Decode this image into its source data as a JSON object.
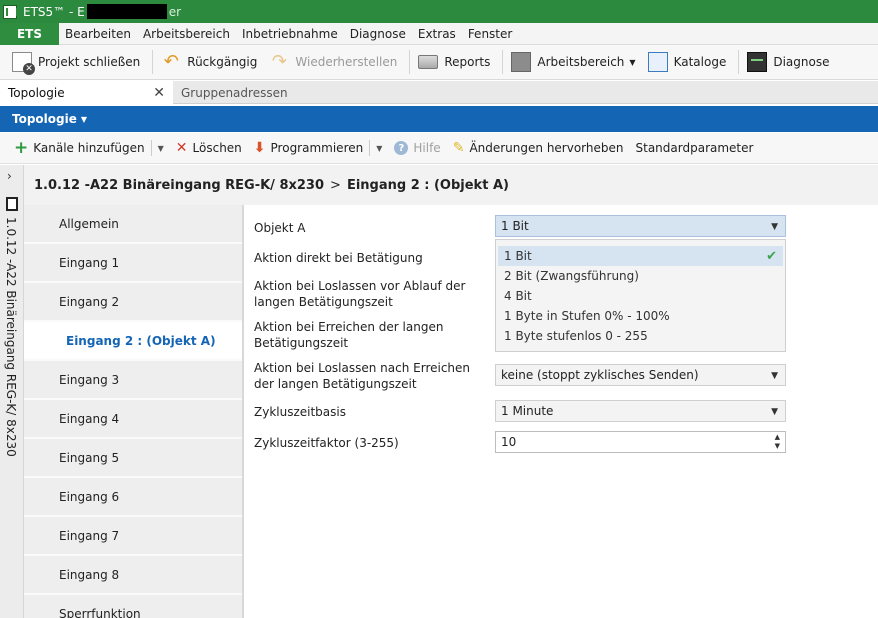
{
  "titlebar": {
    "title": "ETS5™ - E",
    "title_tail": "er"
  },
  "menubar": {
    "ets_label": "ETS",
    "items": [
      "Bearbeiten",
      "Arbeitsbereich",
      "Inbetriebnahme",
      "Diagnose",
      "Extras",
      "Fenster"
    ]
  },
  "toolbar": {
    "close_project": "Projekt schließen",
    "undo": "Rückgängig",
    "redo": "Wiederherstellen",
    "reports": "Reports",
    "workspace": "Arbeitsbereich",
    "catalogs": "Kataloge",
    "diagnose": "Diagnose"
  },
  "tabs": {
    "active": "Topologie",
    "inactive": "Gruppenadressen"
  },
  "header": {
    "title": "Topologie"
  },
  "actionbar": {
    "add_channels": "Kanäle hinzufügen",
    "delete": "Löschen",
    "program": "Programmieren",
    "help": "Hilfe",
    "highlight_changes": "Änderungen hervorheben",
    "default_params": "Standardparameter"
  },
  "vstrip": {
    "device_label": "1.0.12 -A22 Binäreingang REG-K/ 8x230"
  },
  "breadcrumb": {
    "device": "1.0.12 -A22 Binäreingang REG-K/ 8x230",
    "separator": ">",
    "current": "Eingang 2 : (Objekt A)"
  },
  "nav": {
    "items": [
      "Allgemein",
      "Eingang 1",
      "Eingang 2",
      "Eingang 2 : (Objekt A)",
      "Eingang 3",
      "Eingang 4",
      "Eingang 5",
      "Eingang 6",
      "Eingang 7",
      "Eingang 8",
      "Sperrfunktion"
    ]
  },
  "params": {
    "objekt_a_label": "Objekt A",
    "objekt_a_value": "1 Bit",
    "aktion_direkt_label": "Aktion direkt bei Betätigung",
    "aktion_loslassen_vor_label": "Aktion bei Loslassen vor Ablauf der langen Betätigungszeit",
    "aktion_erreichen_label": "Aktion bei Erreichen der langen Betätigungszeit",
    "aktion_loslassen_nach_label": "Aktion bei Loslassen nach Erreichen der langen Betätigungszeit",
    "aktion_loslassen_nach_value": "keine (stoppt zyklisches Senden)",
    "zykluszeitbasis_label": "Zykluszeitbasis",
    "zykluszeitbasis_value": "1 Minute",
    "zykluszeitfaktor_label": "Zykluszeitfaktor (3-255)",
    "zykluszeitfaktor_value": "10"
  },
  "dropdown": {
    "options": [
      "1 Bit",
      "2 Bit (Zwangsführung)",
      "4 Bit",
      "1 Byte in Stufen 0% - 100%",
      "1 Byte stufenlos 0 - 255"
    ]
  },
  "colors": {
    "title_green": "#2b8a3e",
    "header_blue": "#1565b5",
    "active_nav": "#1565b5"
  }
}
